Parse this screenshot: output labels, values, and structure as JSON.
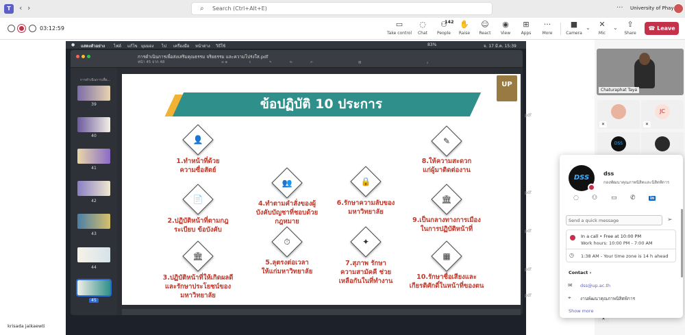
{
  "titlebar": {
    "search_placeholder": "Search (Ctrl+Alt+E)",
    "org_name": "University of Phayao",
    "more": "···"
  },
  "meeting": {
    "timer": "03:12:59",
    "toolbar": {
      "take_control": "Take control",
      "chat": "Chat",
      "people": "People",
      "people_count": "142",
      "raise": "Raise",
      "react": "React",
      "view": "View",
      "apps": "Apps",
      "more": "More",
      "camera": "Camera",
      "mic": "Mic",
      "share": "Share",
      "leave": "Leave"
    }
  },
  "shared_screen": {
    "preview_title": "การดำเนินการเพื่อส่งเสริมคุณธรรม จริยธรรม และความโปร่งใส.pdf",
    "page_indicator": "หน้า 45 จาก 48",
    "sidebar_heading": "การดำเนินการเพื่อ...",
    "mac_menu": {
      "app": "แสดงตัวอย่าง",
      "file": "ไฟล์",
      "edit": "แก้ไข",
      "view": "มุมมอง",
      "go": "ไป",
      "tools": "เครื่องมือ",
      "window": "หน้าต่าง",
      "help": "วิธีใช้",
      "battery": "83%",
      "clock": "จ. 17 มี.ค. 15:39"
    },
    "thumbnails": [
      {
        "page": "39"
      },
      {
        "page": "40"
      },
      {
        "page": "41"
      },
      {
        "page": "42"
      },
      {
        "page": "43"
      },
      {
        "page": "44"
      },
      {
        "page": "45",
        "selected": true
      }
    ],
    "slide": {
      "title": "ข้อปฏิบัติ 10 ประการ",
      "logo": "UP",
      "items": [
        {
          "text": "1.ทำหน้าที่ด้วย\nความซื่อสัตย์",
          "icon": "👤"
        },
        {
          "text": "2.ปฏิบัติหน้าที่ตามกฎ\nระเบียบ ข้อบังคับ",
          "icon": "📄"
        },
        {
          "text": "3.ปฏิบัติหน้าที่ให้เกิดผลดี\nและรักษาประโยชน์ของ\nมหาวิทยาลัย",
          "icon": "🏛"
        },
        {
          "text": "4.ทำตามคำสั่งของผู้\nบังคับบัญชาที่ชอบด้วย\nกฎหมาย",
          "icon": "👥"
        },
        {
          "text": "5.ลุตรงต่อเวลา\nให้แก่มหาวิทยาลัย",
          "icon": "⏱"
        },
        {
          "text": "6.รักษาความลับของ\nมหาวิทยาลัย",
          "icon": "🔒"
        },
        {
          "text": "7.สุภาพ รักษา\nความสามัคคี ช่วย\nเหลือกันในที่ทำงาน",
          "icon": "✦"
        },
        {
          "text": "8.ให้ความสะดวก\nแก่ผู้มาติดต่องาน",
          "icon": "✎"
        },
        {
          "text": "9.เป็นกลางทางการเมือง\nในการปฏิบัติหน้าที่",
          "icon": "🏛"
        },
        {
          "text": "10.รักษาชื่อเสียงและ\nเกียรติศักดิ์ในหน้าที่ของตน",
          "icon": "▦"
        }
      ]
    },
    "presenter_label": "krisada jaikaewti",
    "side_text": [
      "pdf",
      "pdf",
      "pdf",
      "pdf",
      "pdf"
    ]
  },
  "participants": {
    "featured_name": "Chaturaphat Taya",
    "tiles": [
      {
        "initials": ""
      },
      {
        "initials": "JC"
      },
      {
        "initials": "DSS"
      },
      {
        "initials": ""
      }
    ]
  },
  "profile_card": {
    "avatar_text": "DSS",
    "name": "dss",
    "org": "กองพัฒนาคุณภาพนิสิตและนิสิตพิการ",
    "message_placeholder": "Send a quick message",
    "linkedin": "in",
    "status_line": "In a call • Free at 10:00 PM",
    "work_hours": "Work hours: 10:00 PM - 7:00 AM",
    "local_time": "1:38 AM - Your time zone is 14 h ahead",
    "contact_heading": "Contact",
    "email": "dss@up.ac.th",
    "department": "งานพัฒนาคุณภาพนิสิตพิการ",
    "show_more": "Show more"
  },
  "colors": {
    "teams_purple": "#5b5fc7",
    "leave_red": "#c4314b",
    "slide_teal": "#2f8f8a",
    "slide_gold": "#f2b233",
    "slide_text_red": "#c0392b"
  }
}
